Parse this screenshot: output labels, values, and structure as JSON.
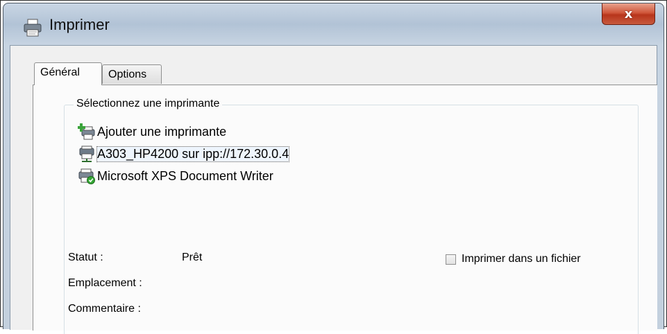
{
  "window": {
    "title": "Imprimer",
    "close_glyph": "x"
  },
  "tabs": [
    {
      "label": "Général",
      "active": true
    },
    {
      "label": "Options",
      "active": false
    }
  ],
  "printer_group": {
    "label": "Sélectionnez une imprimante",
    "items": [
      {
        "label": "Ajouter une imprimante",
        "icon": "add-printer-icon",
        "selected": false
      },
      {
        "label": "A303_HP4200 sur ipp://172.30.0.4",
        "icon": "network-printer-icon",
        "selected": true
      },
      {
        "label": "Microsoft XPS Document Writer",
        "icon": "default-printer-icon",
        "selected": false
      }
    ]
  },
  "info": {
    "status_label": "Statut :",
    "status_value": "Prêt",
    "location_label": "Emplacement :",
    "comment_label": "Commentaire :"
  },
  "print_to_file": {
    "label": "Imprimer dans un fichier",
    "checked": false
  },
  "colors": {
    "selection_outline": "#555555",
    "close_button": "#c9452a",
    "title_bar": "#c3d0de"
  }
}
